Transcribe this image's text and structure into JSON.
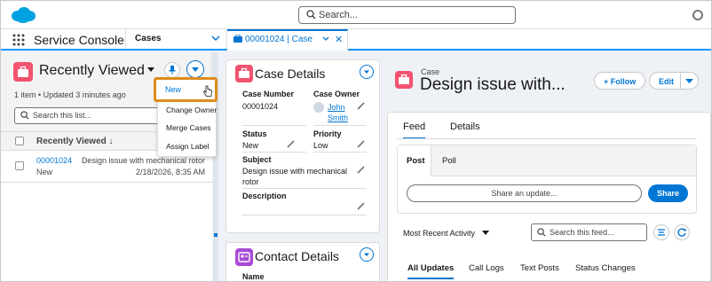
{
  "header": {
    "search_placeholder": "Search..."
  },
  "nav": {
    "app_name": "Service Console",
    "object_tab": "Cases",
    "workspace_tab": "00001024 | Case"
  },
  "list_view": {
    "title": "Recently Viewed",
    "subtitle": "1 item • Updated 3 minutes ago",
    "search_placeholder": "Search this list...",
    "column_header": "Recently Viewed",
    "sort_indicator": "↓",
    "rows": [
      {
        "case_number": "00001024",
        "status": "New",
        "subject": "Design issue with mechanical rotor",
        "date": "2/18/2026, 8:35 AM"
      }
    ]
  },
  "dropdown_menu": {
    "items": [
      "New",
      "Change Owner",
      "Merge Cases",
      "Assign Label"
    ]
  },
  "case_details": {
    "title": "Case Details",
    "case_number_label": "Case Number",
    "case_number_value": "00001024",
    "case_owner_label": "Case Owner",
    "owner_first": "John",
    "owner_last": "Smith",
    "status_label": "Status",
    "status_value": "New",
    "priority_label": "Priority",
    "priority_value": "Low",
    "subject_label": "Subject",
    "subject_line1": "Design issue with mechanical",
    "subject_line2": "rotor",
    "description_label": "Description"
  },
  "contact_details": {
    "title": "Contact Details",
    "name_label": "Name"
  },
  "record": {
    "kind": "Case",
    "title": "Design issue with...",
    "follow_label": "+ Follow",
    "edit_label": "Edit"
  },
  "feed": {
    "tabs": [
      "Feed",
      "Details"
    ],
    "publisher_tabs": [
      "Post",
      "Poll"
    ],
    "share_placeholder": "Share an update...",
    "share_button": "Share",
    "sort_label": "Most Recent Activity",
    "search_placeholder": "Search this feed...",
    "filters": [
      "All Updates",
      "Call Logs",
      "Text Posts",
      "Status Changes"
    ]
  },
  "colors": {
    "brand": "#0176d3",
    "case_icon": "#f2536f",
    "contact_icon": "#a94bd6",
    "highlight": "#e08b1d"
  }
}
